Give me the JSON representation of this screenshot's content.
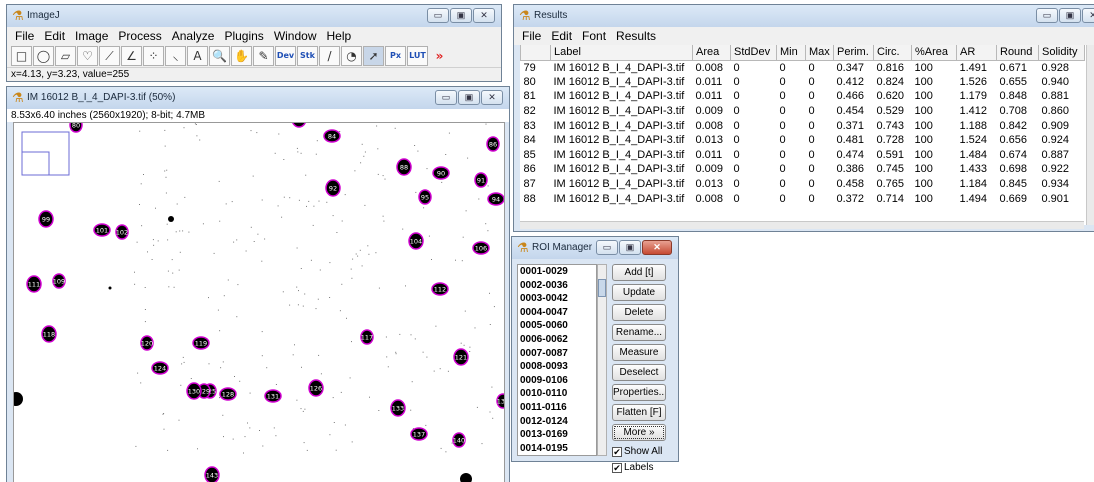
{
  "imagej": {
    "title": "ImageJ",
    "menus": [
      "File",
      "Edit",
      "Image",
      "Process",
      "Analyze",
      "Plugins",
      "Window",
      "Help"
    ],
    "tools": [
      {
        "icon": "rectangle-tool-icon",
        "glyph": "□"
      },
      {
        "icon": "oval-tool-icon",
        "glyph": "◯"
      },
      {
        "icon": "polygon-tool-icon",
        "glyph": "▱"
      },
      {
        "icon": "freehand-tool-icon",
        "glyph": "♡"
      },
      {
        "icon": "line-tool-icon",
        "glyph": "⟋"
      },
      {
        "icon": "angle-tool-icon",
        "glyph": "∠"
      },
      {
        "icon": "point-tool-icon",
        "glyph": "⁘"
      },
      {
        "icon": "wand-tool-icon",
        "glyph": "⸜"
      },
      {
        "icon": "text-tool-icon",
        "glyph": "A"
      },
      {
        "icon": "magnifier-tool-icon",
        "glyph": "🔍"
      },
      {
        "icon": "hand-tool-icon",
        "glyph": "✋"
      },
      {
        "icon": "color-picker-tool-icon",
        "glyph": "✎"
      },
      {
        "icon": "developer-menu-icon",
        "glyph": "Dev"
      },
      {
        "icon": "stack-menu-icon",
        "glyph": "Stk"
      },
      {
        "icon": "brush-tool-icon",
        "glyph": "/"
      },
      {
        "icon": "flood-fill-tool-icon",
        "glyph": "◔"
      },
      {
        "icon": "arrow-tool-icon",
        "glyph": "➚"
      },
      {
        "icon": "pixel-inspector-icon",
        "glyph": "Px"
      },
      {
        "icon": "lut-menu-icon",
        "glyph": "LUT"
      },
      {
        "icon": "more-tools-icon",
        "glyph": "»"
      }
    ],
    "status": "x=4.13, y=3.23, value=255"
  },
  "image_window": {
    "title": "IM 16012 B_I_4_DAPI-3.tif (50%)",
    "info": "8.53x6.40 inches (2560x1920); 8-bit; 4.7MB",
    "roi_labels": [
      "80",
      "79",
      "84",
      "86",
      "88",
      "90",
      "91",
      "92",
      "94",
      "95",
      "99",
      "101",
      "102",
      "104",
      "106",
      "109",
      "111",
      "112",
      "117",
      "118",
      "119",
      "120",
      "121",
      "124",
      "125",
      "126",
      "128",
      "129",
      "130",
      "131",
      "132",
      "133",
      "137",
      "140",
      "143"
    ]
  },
  "results": {
    "title": "Results",
    "menus": [
      "File",
      "Edit",
      "Font",
      "Results"
    ],
    "columns": [
      "",
      "Label",
      "Area",
      "StdDev",
      "Min",
      "Max",
      "Perim.",
      "Circ.",
      "%Area",
      "AR",
      "Round",
      "Solidity"
    ],
    "rows": [
      [
        "79",
        "IM 16012 B_I_4_DAPI-3.tif",
        "0.008",
        "0",
        "0",
        "0",
        "0.347",
        "0.816",
        "100",
        "1.491",
        "0.671",
        "0.928"
      ],
      [
        "80",
        "IM 16012 B_I_4_DAPI-3.tif",
        "0.011",
        "0",
        "0",
        "0",
        "0.412",
        "0.824",
        "100",
        "1.526",
        "0.655",
        "0.940"
      ],
      [
        "81",
        "IM 16012 B_I_4_DAPI-3.tif",
        "0.011",
        "0",
        "0",
        "0",
        "0.466",
        "0.620",
        "100",
        "1.179",
        "0.848",
        "0.881"
      ],
      [
        "82",
        "IM 16012 B_I_4_DAPI-3.tif",
        "0.009",
        "0",
        "0",
        "0",
        "0.454",
        "0.529",
        "100",
        "1.412",
        "0.708",
        "0.860"
      ],
      [
        "83",
        "IM 16012 B_I_4_DAPI-3.tif",
        "0.008",
        "0",
        "0",
        "0",
        "0.371",
        "0.743",
        "100",
        "1.188",
        "0.842",
        "0.909"
      ],
      [
        "84",
        "IM 16012 B_I_4_DAPI-3.tif",
        "0.013",
        "0",
        "0",
        "0",
        "0.481",
        "0.728",
        "100",
        "1.524",
        "0.656",
        "0.924"
      ],
      [
        "85",
        "IM 16012 B_I_4_DAPI-3.tif",
        "0.011",
        "0",
        "0",
        "0",
        "0.474",
        "0.591",
        "100",
        "1.484",
        "0.674",
        "0.887"
      ],
      [
        "86",
        "IM 16012 B_I_4_DAPI-3.tif",
        "0.009",
        "0",
        "0",
        "0",
        "0.386",
        "0.745",
        "100",
        "1.433",
        "0.698",
        "0.922"
      ],
      [
        "87",
        "IM 16012 B_I_4_DAPI-3.tif",
        "0.013",
        "0",
        "0",
        "0",
        "0.458",
        "0.765",
        "100",
        "1.184",
        "0.845",
        "0.934"
      ],
      [
        "88",
        "IM 16012 B_I_4_DAPI-3.tif",
        "0.008",
        "0",
        "0",
        "0",
        "0.372",
        "0.714",
        "100",
        "1.494",
        "0.669",
        "0.901"
      ]
    ]
  },
  "roi_manager": {
    "title": "ROI Manager",
    "items": [
      "0001-0029",
      "0002-0036",
      "0003-0042",
      "0004-0047",
      "0005-0060",
      "0006-0062",
      "0007-0087",
      "0008-0093",
      "0009-0106",
      "0010-0110",
      "0011-0116",
      "0012-0124",
      "0013-0169",
      "0014-0195"
    ],
    "buttons": [
      "Add [t]",
      "Update",
      "Delete",
      "Rename...",
      "Measure",
      "Deselect",
      "Properties...",
      "Flatten [F]",
      "More »"
    ],
    "show_all_label": "Show All",
    "labels_label": "Labels",
    "show_all_checked": true,
    "labels_checked": true
  },
  "colors": {
    "roi_outline": "#d000d0",
    "nucleus": "#000000",
    "title_bar": "#c4d6ec",
    "close_button": "#c64a33"
  }
}
